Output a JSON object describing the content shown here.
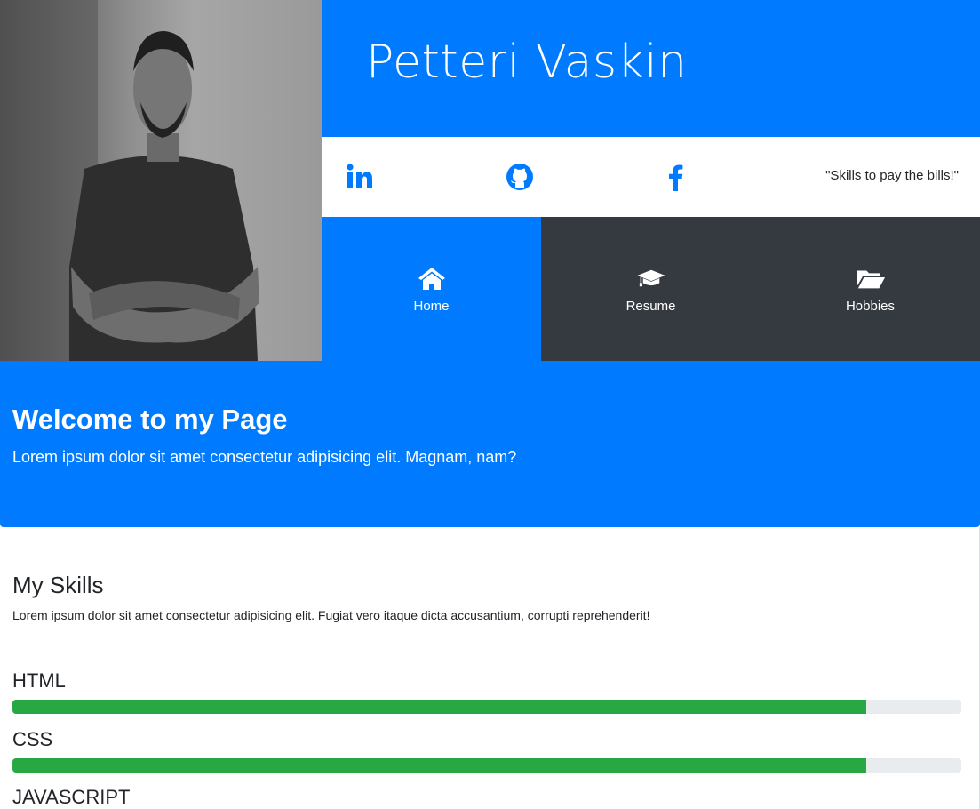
{
  "header": {
    "name": "Petteri Vaskin",
    "quote": "\"Skills to pay the bills!\"",
    "social": [
      {
        "icon": "linkedin-icon"
      },
      {
        "icon": "github-icon"
      },
      {
        "icon": "facebook-icon"
      }
    ]
  },
  "nav": [
    {
      "label": "Home",
      "icon": "home-icon",
      "active": true
    },
    {
      "label": "Resume",
      "icon": "graduation-cap-icon",
      "active": false
    },
    {
      "label": "Hobbies",
      "icon": "folder-open-icon",
      "active": false
    }
  ],
  "welcome": {
    "title": "Welcome to my Page",
    "text": "Lorem ipsum dolor sit amet consectetur adipisicing elit. Magnam, nam?"
  },
  "skills": {
    "title": "My Skills",
    "intro": "Lorem ipsum dolor sit amet consectetur adipisicing elit. Fugiat vero itaque dicta accusantium, corrupti reprehenderit!",
    "items": [
      {
        "name": "HTML",
        "level": 0.9
      },
      {
        "name": "CSS",
        "level": 0.9
      },
      {
        "name": "JAVASCRIPT"
      }
    ]
  },
  "colors": {
    "primary": "#007bff",
    "dark": "#343a40",
    "success": "#28a745",
    "track": "#e9ecef"
  }
}
